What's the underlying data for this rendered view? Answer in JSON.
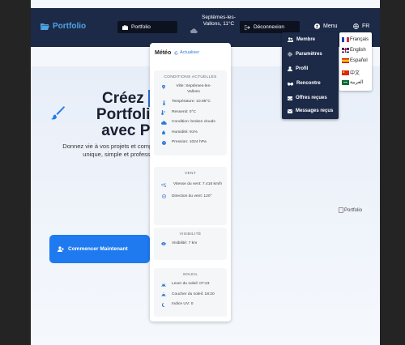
{
  "navbar": {
    "brand": "Portfolio",
    "portfolio_label": "Portfolio",
    "weather_text": "Septèmes-les-Vallons, 11°C",
    "login_label": "Déconnexion",
    "menu_label": "Menu",
    "lang_label": "FR"
  },
  "hero": {
    "title_line1_a": "Créez ",
    "title_line1_b": "Vo",
    "title_line2": "Portfolio G",
    "title_line3": "avec Port",
    "subtitle": "Donnez vie à vos projets et compétence unique, simple et profess",
    "cta_label": "Commencer Maintenant",
    "image_alt": "Portfolio"
  },
  "weather": {
    "title": "Météo",
    "refresh": "Actualiser",
    "conditions": {
      "title": "CONDITIONS ACTUELLES",
      "ville": "Ville: Septèmes-les-Vallons",
      "temperature": "Température: 10.95°C",
      "ressenti": "Ressenti: 0°C",
      "condition": "Condition: broken clouds",
      "humidite": "Humidité: 91%",
      "pression": "Pression: 1024 hPa"
    },
    "vent": {
      "title": "VENT",
      "vitesse": "Vitesse du vent: 7.416 km/h",
      "direction": "Direction du vent: 120°"
    },
    "visibilite": {
      "title": "VISIBILITÉ",
      "value": "Visibilité: 7 km"
    },
    "soleil": {
      "title": "SOLEIL",
      "lever": "Lever du soleil: 07:23",
      "coucher": "Coucher du soleil: 18:20",
      "uv": "Indice UV: 0"
    }
  },
  "menu": {
    "items": [
      "Membre",
      "Paramètres",
      "Profil",
      "Rencontre",
      "Offres reçues",
      "Messages reçus"
    ]
  },
  "languages": {
    "items": [
      "Français",
      "English",
      "Español",
      "中文",
      "العربية"
    ]
  },
  "colors": {
    "navbar": "#1c2a48",
    "accent": "#1f7af0",
    "brand": "#4ea3e6"
  }
}
